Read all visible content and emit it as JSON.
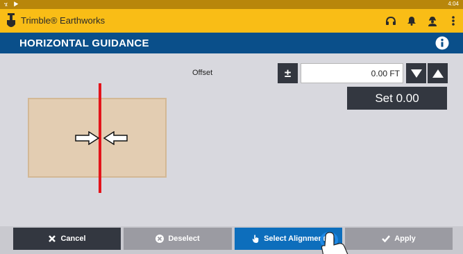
{
  "statusbar": {
    "left_icons": "ሄ ▶",
    "time": "4:04"
  },
  "appbar": {
    "title": "Trimble® Earthworks",
    "icons": [
      "shovel-icon",
      "headset-icon",
      "bell-icon",
      "operator-icon",
      "more-vert-icon"
    ]
  },
  "header": {
    "title": "HORIZONTAL GUIDANCE",
    "info_icon": "info-icon"
  },
  "offset": {
    "label": "Offset",
    "plus_minus_label": "±",
    "value": "0.00 FT",
    "down_icon": "triangle-down-icon",
    "up_icon": "triangle-up-icon",
    "set_label": "Set 0.00"
  },
  "diagram": {
    "block_color": "#e3cdb2",
    "line_color": "#e3141b"
  },
  "footer": {
    "cancel_label": "Cancel",
    "deselect_label": "Deselect",
    "select_alignment_label": "Select Alignment",
    "apply_label": "Apply"
  },
  "colors": {
    "status": "#b8860b",
    "appbar": "#f9bd16",
    "titlebar": "#0a4f8a",
    "button_dark": "#333740",
    "button_disabled": "#9b9ba2",
    "button_primary": "#0d6ebc"
  }
}
